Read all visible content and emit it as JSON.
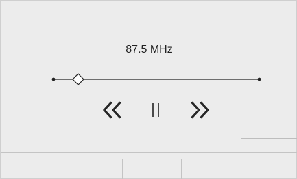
{
  "tuner": {
    "frequency_label": "87.5 MHz",
    "slider_level": 0.12
  },
  "controls": {
    "previous_icon": "double-chevron-left-icon",
    "pause_icon": "pause-icon",
    "next_icon": "double-chevron-right-icon"
  },
  "colors": {
    "background": "#ececec",
    "foreground": "#222222",
    "divider": "#c4c4c4"
  }
}
